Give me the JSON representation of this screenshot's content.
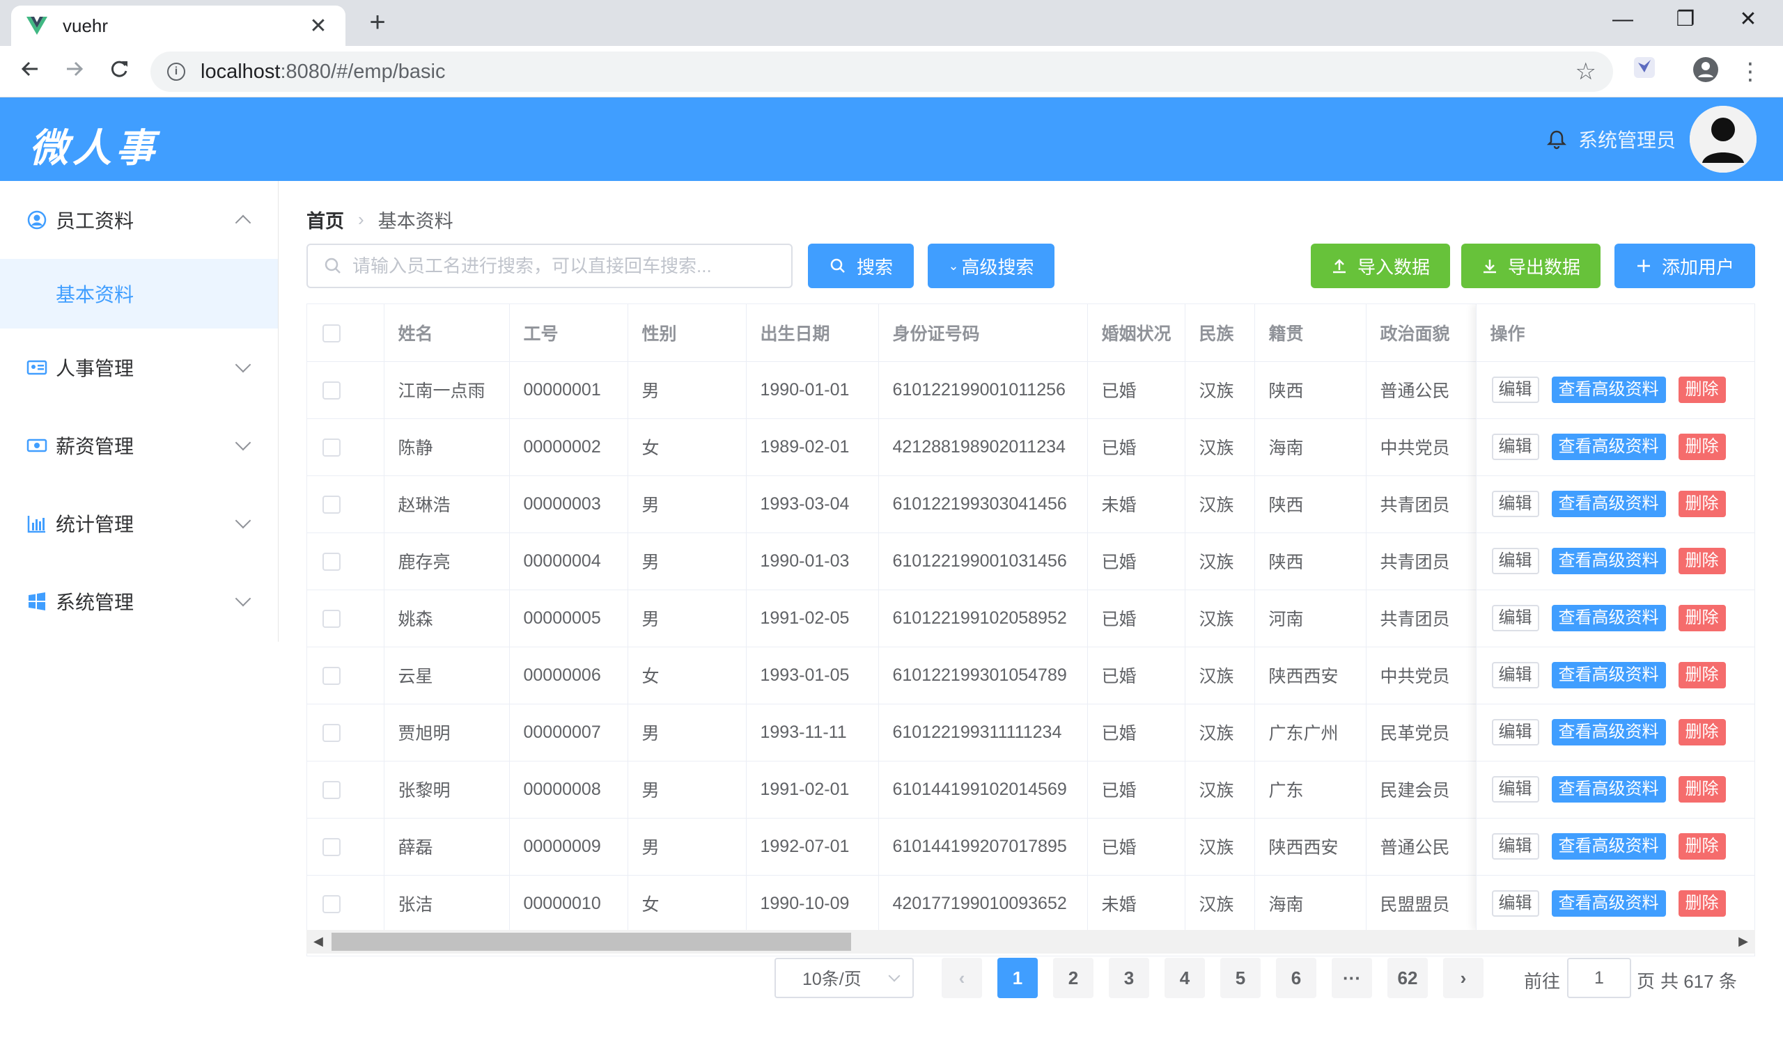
{
  "browser": {
    "tab_title": "vuehr",
    "tab_close": "✕",
    "new_tab": "+",
    "url_host": "localhost",
    "url_path": ":8080/#/emp/basic",
    "win_min": "—",
    "win_max": "❐",
    "win_close": "✕"
  },
  "header": {
    "logo": "微人事",
    "username": "系统管理员"
  },
  "sidebar": {
    "items": [
      {
        "label": "员工资料",
        "icon": "user-circle-icon",
        "expanded": true
      },
      {
        "label": "人事管理",
        "icon": "id-card-icon"
      },
      {
        "label": "薪资管理",
        "icon": "money-icon"
      },
      {
        "label": "统计管理",
        "icon": "bar-chart-icon"
      },
      {
        "label": "系统管理",
        "icon": "windows-icon"
      }
    ],
    "subitem": "基本资料"
  },
  "breadcrumb": {
    "home": "首页",
    "separator": "›",
    "current": "基本资料"
  },
  "search": {
    "placeholder": "请输入员工名进行搜索，可以直接回车搜索...",
    "search_label": "搜索",
    "advanced_label": "高级搜索",
    "import_label": "导入数据",
    "export_label": "导出数据",
    "add_label": "添加用户"
  },
  "table": {
    "headers": [
      "姓名",
      "工号",
      "性别",
      "出生日期",
      "身份证号码",
      "婚姻状况",
      "民族",
      "籍贯",
      "政治面貌",
      "操作"
    ],
    "ops": {
      "edit": "编辑",
      "view": "查看高级资料",
      "delete": "删除"
    },
    "rows": [
      [
        "江南一点雨",
        "00000001",
        "男",
        "1990-01-01",
        "610122199001011256",
        "已婚",
        "汉族",
        "陕西",
        "普通公民"
      ],
      [
        "陈静",
        "00000002",
        "女",
        "1989-02-01",
        "421288198902011234",
        "已婚",
        "汉族",
        "海南",
        "中共党员"
      ],
      [
        "赵琳浩",
        "00000003",
        "男",
        "1993-03-04",
        "610122199303041456",
        "未婚",
        "汉族",
        "陕西",
        "共青团员"
      ],
      [
        "鹿存亮",
        "00000004",
        "男",
        "1990-01-03",
        "610122199001031456",
        "已婚",
        "汉族",
        "陕西",
        "共青团员"
      ],
      [
        "姚森",
        "00000005",
        "男",
        "1991-02-05",
        "610122199102058952",
        "已婚",
        "汉族",
        "河南",
        "共青团员"
      ],
      [
        "云星",
        "00000006",
        "女",
        "1993-01-05",
        "610122199301054789",
        "已婚",
        "汉族",
        "陕西西安",
        "中共党员"
      ],
      [
        "贾旭明",
        "00000007",
        "男",
        "1993-11-11",
        "610122199311111234",
        "已婚",
        "汉族",
        "广东广州",
        "民革党员"
      ],
      [
        "张黎明",
        "00000008",
        "男",
        "1991-02-01",
        "610144199102014569",
        "已婚",
        "汉族",
        "广东",
        "民建会员"
      ],
      [
        "薛磊",
        "00000009",
        "男",
        "1992-07-01",
        "610144199207017895",
        "已婚",
        "汉族",
        "陕西西安",
        "普通公民"
      ],
      [
        "张洁",
        "00000010",
        "女",
        "1990-10-09",
        "420177199010093652",
        "未婚",
        "汉族",
        "海南",
        "民盟盟员"
      ]
    ],
    "scroll_position": 0.0
  },
  "pagination": {
    "page_size": "10条/页",
    "prev": "‹",
    "next": "›",
    "pages": [
      "1",
      "2",
      "3",
      "4",
      "5",
      "6",
      "···",
      "62"
    ],
    "current": "1",
    "goto_prefix": "前往",
    "goto_value": "1",
    "goto_suffix": "页",
    "total": "共 617 条"
  },
  "colors": {
    "primary": "#409eff",
    "success": "#67c23a",
    "danger": "#f56c6c"
  }
}
